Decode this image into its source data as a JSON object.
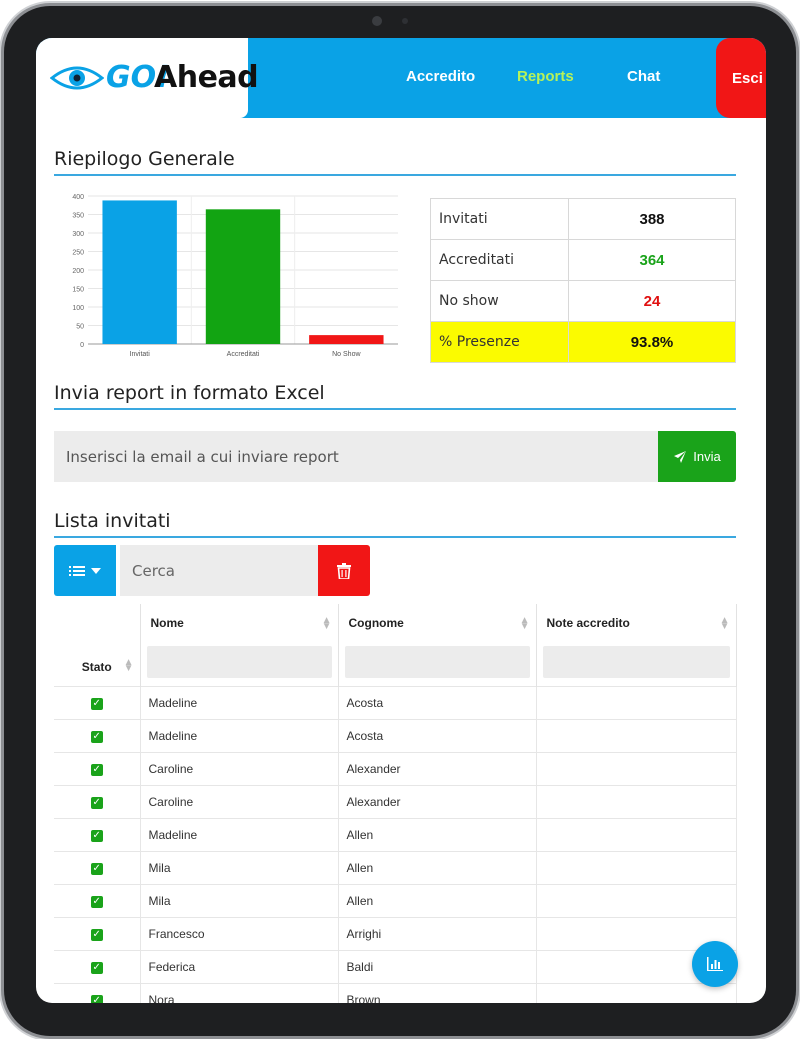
{
  "brand": {
    "logo_go": "GO!",
    "logo_ahead": "Ahead"
  },
  "nav": {
    "items": [
      {
        "label": "Accredito",
        "active": false
      },
      {
        "label": "Reports",
        "active": true
      },
      {
        "label": "Chat",
        "active": false
      }
    ],
    "exit_label": "Esci"
  },
  "summary_section": {
    "title": "Riepilogo Generale"
  },
  "chart_data": {
    "type": "bar",
    "categories": [
      "Invitati",
      "Accreditati",
      "No Show"
    ],
    "values": [
      388,
      364,
      24
    ],
    "colors": [
      "#0aa2e6",
      "#12a412",
      "#f11616"
    ],
    "ylim": [
      0,
      400
    ],
    "yticks": [
      0,
      50,
      100,
      150,
      200,
      250,
      300,
      350,
      400
    ],
    "grid": true
  },
  "summary_table": [
    {
      "label": "Invitati",
      "value": "388",
      "color": "#111111"
    },
    {
      "label": "Accreditati",
      "value": "364",
      "color": "#1aa31a"
    },
    {
      "label": "No show",
      "value": "24",
      "color": "#e01010"
    },
    {
      "label": "% Presenze",
      "value": "93.8%",
      "color": "#111111"
    }
  ],
  "report_section": {
    "title": "Invia report in formato Excel",
    "email_placeholder": "Inserisci la email a cui inviare report",
    "send_label": "Invia"
  },
  "list_section": {
    "title": "Lista invitati",
    "search_placeholder": "Cerca"
  },
  "table": {
    "columns": {
      "stato": "Stato",
      "nome": "Nome",
      "cognome": "Cognome",
      "note": "Note accredito"
    },
    "rows": [
      {
        "nome": "Madeline",
        "cognome": "Acosta",
        "note": ""
      },
      {
        "nome": "Madeline",
        "cognome": "Acosta",
        "note": ""
      },
      {
        "nome": "Caroline",
        "cognome": "Alexander",
        "note": ""
      },
      {
        "nome": "Caroline",
        "cognome": "Alexander",
        "note": ""
      },
      {
        "nome": "Madeline",
        "cognome": "Allen",
        "note": ""
      },
      {
        "nome": "Mila",
        "cognome": "Allen",
        "note": ""
      },
      {
        "nome": "Mila",
        "cognome": "Allen",
        "note": ""
      },
      {
        "nome": "Francesco",
        "cognome": "Arrighi",
        "note": ""
      },
      {
        "nome": "Federica",
        "cognome": "Baldi",
        "note": ""
      },
      {
        "nome": "Nora",
        "cognome": "Brown",
        "note": ""
      }
    ]
  }
}
